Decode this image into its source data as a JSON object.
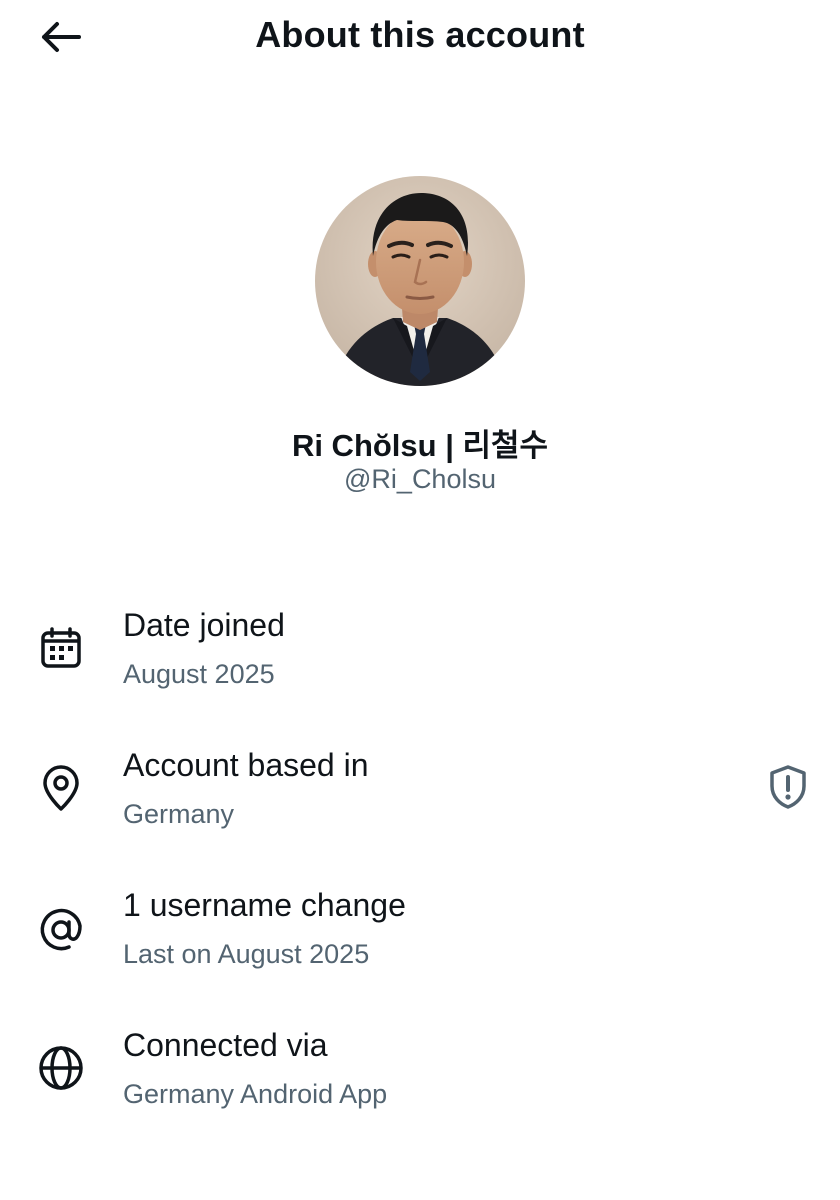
{
  "header": {
    "title": "About this account",
    "back_icon": "arrow-left-icon"
  },
  "profile": {
    "display_name": "Ri Chŏlsu | 리철수",
    "handle": "@Ri_Cholsu",
    "avatar": "avatar-photo"
  },
  "rows": [
    {
      "icon": "calendar-icon",
      "title": "Date joined",
      "subtitle": "August 2025"
    },
    {
      "icon": "location-pin-icon",
      "title": "Account based in",
      "subtitle": "Germany",
      "action_icon": "shield-alert-icon"
    },
    {
      "icon": "at-sign-icon",
      "title": "1 username change",
      "subtitle": "Last on August 2025"
    },
    {
      "icon": "globe-icon",
      "title": "Connected via",
      "subtitle": "Germany Android App"
    }
  ],
  "colors": {
    "text_primary": "#0f1419",
    "text_secondary": "#536471",
    "background": "#ffffff"
  }
}
